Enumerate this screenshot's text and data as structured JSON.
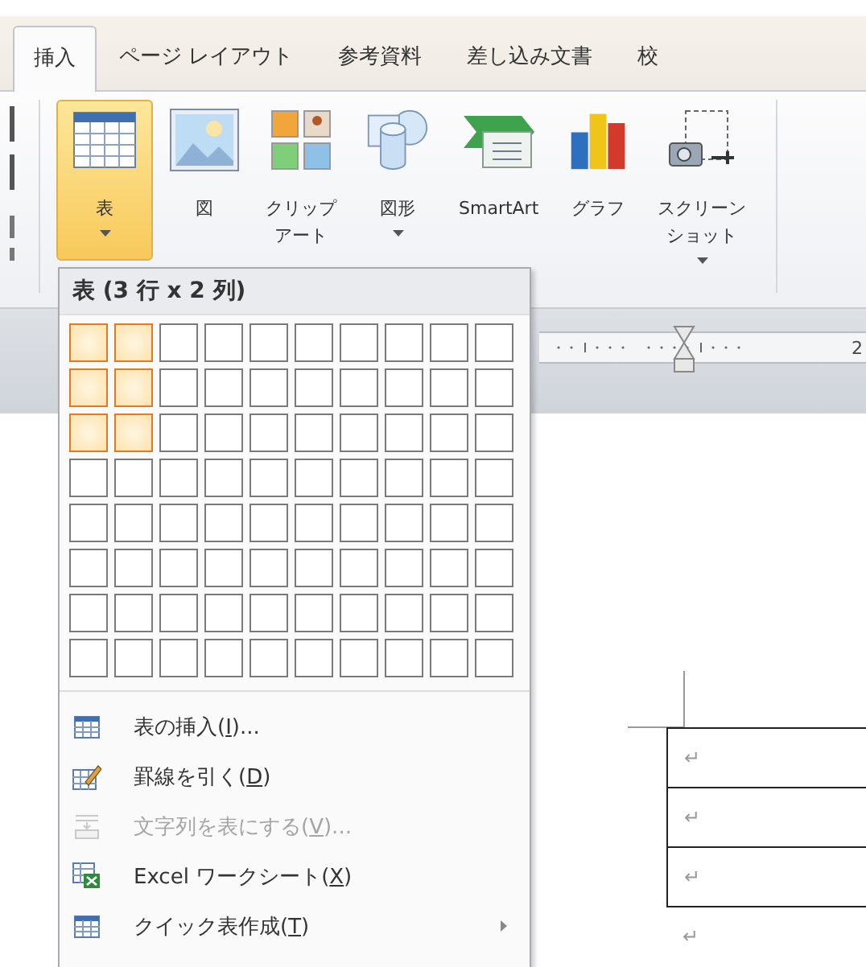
{
  "tabs": [
    {
      "label": "挿入",
      "selected": true
    },
    {
      "label": "ページ レイアウト",
      "selected": false
    },
    {
      "label": "参考資料",
      "selected": false
    },
    {
      "label": "差し込み文書",
      "selected": false
    },
    {
      "label": "校",
      "selected": false
    }
  ],
  "ribbon": {
    "buttons": [
      {
        "kind": "table",
        "lines": [
          "表"
        ],
        "has_menu": true,
        "selected": true
      },
      {
        "kind": "picture",
        "lines": [
          "図"
        ],
        "has_menu": false,
        "selected": false
      },
      {
        "kind": "clipart",
        "lines": [
          "クリップ",
          "アート"
        ],
        "has_menu": false,
        "selected": false
      },
      {
        "kind": "shapes",
        "lines": [
          "図形"
        ],
        "has_menu": true,
        "selected": false
      },
      {
        "kind": "smartart",
        "lines": [
          "SmartArt"
        ],
        "has_menu": false,
        "selected": false
      },
      {
        "kind": "chart",
        "lines": [
          "グラフ"
        ],
        "has_menu": false,
        "selected": false
      },
      {
        "kind": "screenshot",
        "lines": [
          "スクリーン",
          "ショット"
        ],
        "has_menu": true,
        "selected": false
      }
    ]
  },
  "menu": {
    "header": "表 (3 行 x 2 列)",
    "grid": [
      [
        {
          "selected": true
        },
        {
          "selected": true
        },
        {
          "selected": false
        },
        {
          "selected": false
        },
        {
          "selected": false
        },
        {
          "selected": false
        },
        {
          "selected": false
        },
        {
          "selected": false
        },
        {
          "selected": false
        },
        {
          "selected": false
        }
      ],
      [
        {
          "selected": true
        },
        {
          "selected": true
        },
        {
          "selected": false
        },
        {
          "selected": false
        },
        {
          "selected": false
        },
        {
          "selected": false
        },
        {
          "selected": false
        },
        {
          "selected": false
        },
        {
          "selected": false
        },
        {
          "selected": false
        }
      ],
      [
        {
          "selected": true
        },
        {
          "selected": true
        },
        {
          "selected": false
        },
        {
          "selected": false
        },
        {
          "selected": false
        },
        {
          "selected": false
        },
        {
          "selected": false
        },
        {
          "selected": false
        },
        {
          "selected": false
        },
        {
          "selected": false
        }
      ],
      [
        {
          "selected": false
        },
        {
          "selected": false
        },
        {
          "selected": false
        },
        {
          "selected": false
        },
        {
          "selected": false
        },
        {
          "selected": false
        },
        {
          "selected": false
        },
        {
          "selected": false
        },
        {
          "selected": false
        },
        {
          "selected": false
        }
      ],
      [
        {
          "selected": false
        },
        {
          "selected": false
        },
        {
          "selected": false
        },
        {
          "selected": false
        },
        {
          "selected": false
        },
        {
          "selected": false
        },
        {
          "selected": false
        },
        {
          "selected": false
        },
        {
          "selected": false
        },
        {
          "selected": false
        }
      ],
      [
        {
          "selected": false
        },
        {
          "selected": false
        },
        {
          "selected": false
        },
        {
          "selected": false
        },
        {
          "selected": false
        },
        {
          "selected": false
        },
        {
          "selected": false
        },
        {
          "selected": false
        },
        {
          "selected": false
        },
        {
          "selected": false
        }
      ],
      [
        {
          "selected": false
        },
        {
          "selected": false
        },
        {
          "selected": false
        },
        {
          "selected": false
        },
        {
          "selected": false
        },
        {
          "selected": false
        },
        {
          "selected": false
        },
        {
          "selected": false
        },
        {
          "selected": false
        },
        {
          "selected": false
        }
      ],
      [
        {
          "selected": false
        },
        {
          "selected": false
        },
        {
          "selected": false
        },
        {
          "selected": false
        },
        {
          "selected": false
        },
        {
          "selected": false
        },
        {
          "selected": false
        },
        {
          "selected": false
        },
        {
          "selected": false
        },
        {
          "selected": false
        }
      ]
    ],
    "items": [
      {
        "kind": "insert",
        "label": "表の挿入(",
        "key": "I",
        "tail": ")...",
        "disabled": false,
        "submenu": false
      },
      {
        "kind": "draw",
        "label": "罫線を引く(",
        "key": "D",
        "tail": ")",
        "disabled": false,
        "submenu": false
      },
      {
        "kind": "convert",
        "label": "文字列を表にする(",
        "key": "V",
        "tail": ")...",
        "disabled": true,
        "submenu": false
      },
      {
        "kind": "excel",
        "label": "Excel ワークシート(",
        "key": "X",
        "tail": ")",
        "disabled": false,
        "submenu": false
      },
      {
        "kind": "quick",
        "label": "クイック表作成(",
        "key": "T",
        "tail": ")",
        "disabled": false,
        "submenu": true
      }
    ]
  },
  "ruler": {
    "number": "2"
  },
  "document": {
    "table_rows": [
      "↵",
      "↵",
      "↵"
    ],
    "after_mark": "↵"
  }
}
